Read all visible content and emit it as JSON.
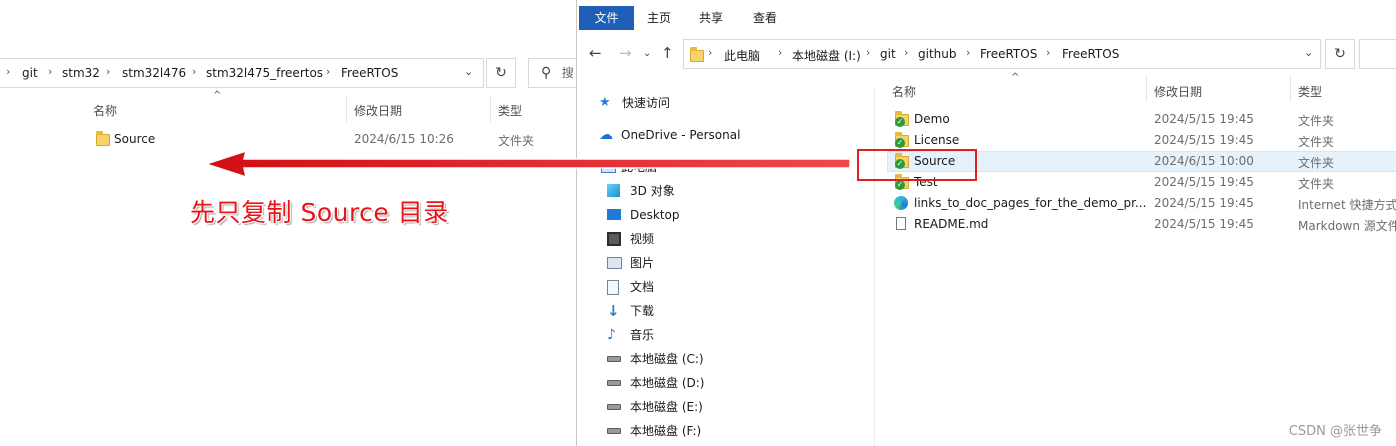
{
  "left_window": {
    "breadcrumb": [
      "git",
      "stm32",
      "stm32l476",
      "stm32l475_freertos",
      "FreeRTOS"
    ],
    "search_partial": "搜",
    "columns": {
      "name": "名称",
      "modified": "修改日期",
      "type": "类型"
    },
    "rows": [
      {
        "name": "Source",
        "modified": "2024/6/15 10:26",
        "type": "文件夹"
      }
    ]
  },
  "right_window": {
    "ribbon_tabs": [
      "文件",
      "主页",
      "共享",
      "查看"
    ],
    "breadcrumb": [
      "此电脑",
      "本地磁盘 (I:)",
      "git",
      "github",
      "FreeRTOS",
      "FreeRTOS"
    ],
    "nav_pane": [
      {
        "label": "快速访问",
        "icon": "star-icon"
      },
      {
        "label": "OneDrive - Personal",
        "icon": "cloud-icon"
      },
      {
        "label": "此电脑",
        "icon": "computer-icon"
      },
      {
        "label": "3D 对象",
        "icon": "cube-icon"
      },
      {
        "label": "Desktop",
        "icon": "desktop-icon"
      },
      {
        "label": "视频",
        "icon": "video-icon"
      },
      {
        "label": "图片",
        "icon": "picture-icon"
      },
      {
        "label": "文档",
        "icon": "document-icon"
      },
      {
        "label": "下载",
        "icon": "download-icon"
      },
      {
        "label": "音乐",
        "icon": "music-icon"
      },
      {
        "label": "本地磁盘 (C:)",
        "icon": "drive-icon"
      },
      {
        "label": "本地磁盘 (D:)",
        "icon": "drive-icon"
      },
      {
        "label": "本地磁盘 (E:)",
        "icon": "drive-icon"
      },
      {
        "label": "本地磁盘 (F:)",
        "icon": "drive-icon"
      }
    ],
    "columns": {
      "name": "名称",
      "modified": "修改日期",
      "type": "类型"
    },
    "files": [
      {
        "name": "Demo",
        "modified": "2024/5/15 19:45",
        "type": "文件夹",
        "icon": "folder-synced-icon"
      },
      {
        "name": "License",
        "modified": "2024/5/15 19:45",
        "type": "文件夹",
        "icon": "folder-synced-icon"
      },
      {
        "name": "Source",
        "modified": "2024/6/15 10:00",
        "type": "文件夹",
        "icon": "folder-synced-icon",
        "selected": true
      },
      {
        "name": "Test",
        "modified": "2024/5/15 19:45",
        "type": "文件夹",
        "icon": "folder-synced-icon"
      },
      {
        "name": "links_to_doc_pages_for_the_demo_pr...",
        "modified": "2024/5/15 19:45",
        "type": "Internet 快捷方式",
        "icon": "edge-shortcut-icon"
      },
      {
        "name": "README.md",
        "modified": "2024/5/15 19:45",
        "type": "Markdown 源文件",
        "icon": "file-icon"
      }
    ]
  },
  "annotation": {
    "text": "先只复制 Source 目录",
    "color": "#e8141a"
  },
  "watermark": "CSDN @张世争",
  "colors": {
    "accent": "#1f5fb8",
    "selection": "#e5f1fb",
    "annotation_red": "#e02020"
  }
}
